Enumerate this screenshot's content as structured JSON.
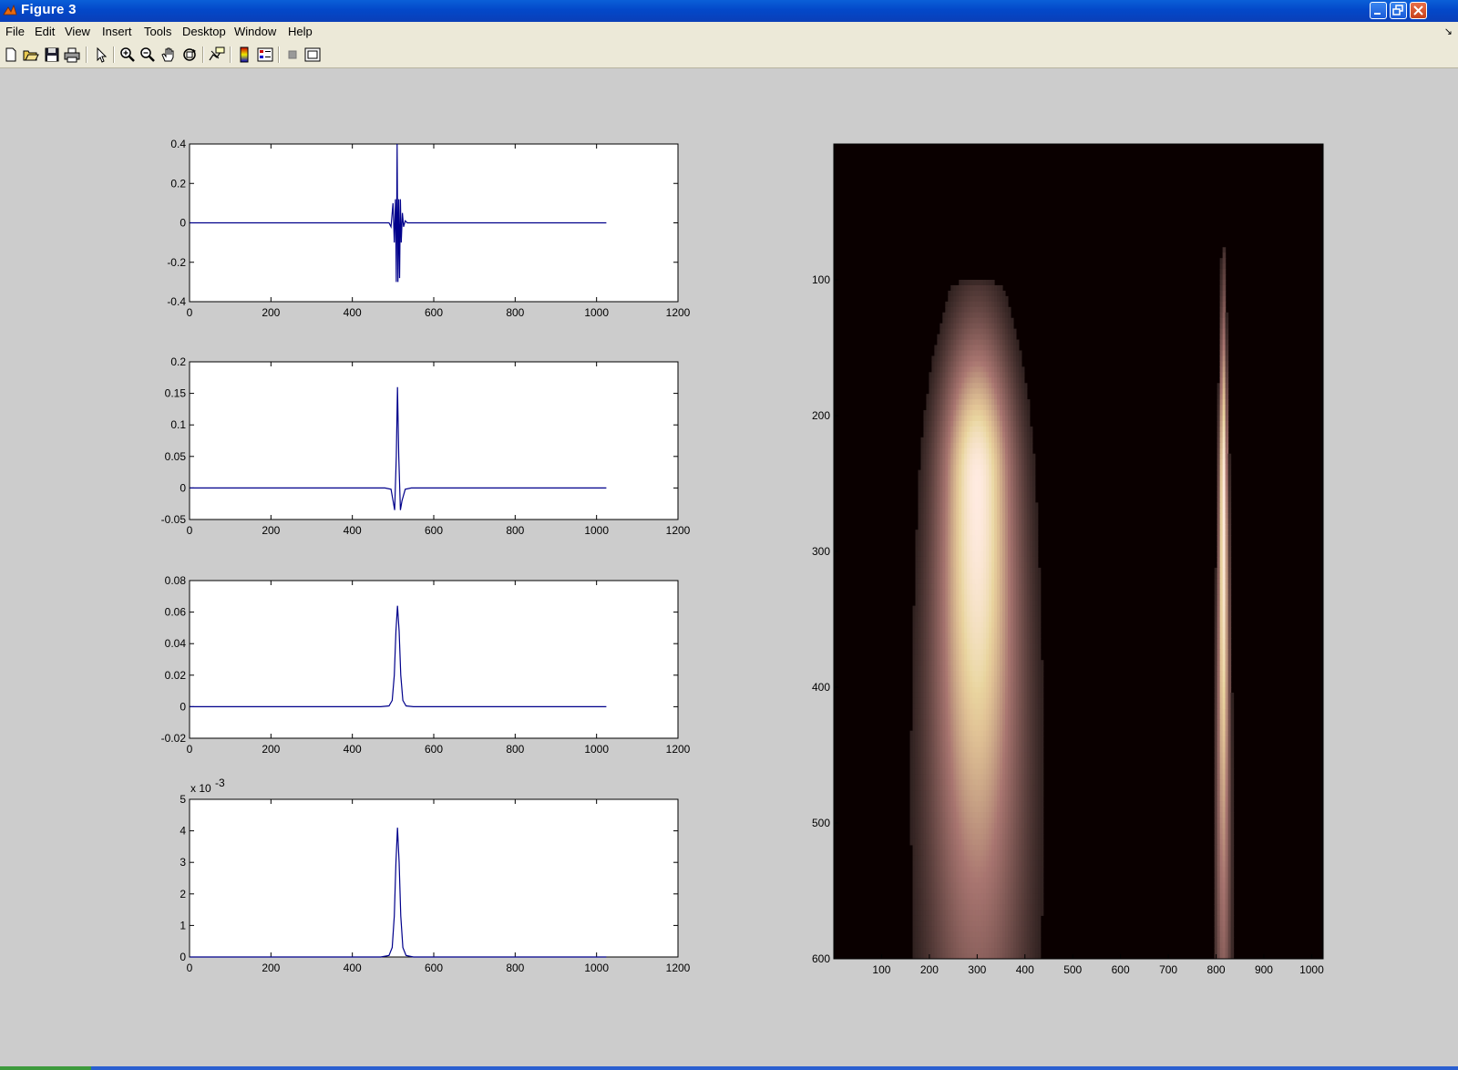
{
  "window": {
    "title": "Figure 3"
  },
  "menu": {
    "items": [
      "File",
      "Edit",
      "View",
      "Insert",
      "Tools",
      "Desktop",
      "Window",
      "Help"
    ]
  },
  "toolbar": {
    "icons": [
      "new-figure-icon",
      "open-file-icon",
      "save-icon",
      "print-icon",
      "edit-plot-arrow-icon",
      "zoom-in-icon",
      "zoom-out-icon",
      "pan-hand-icon",
      "rotate-3d-icon",
      "data-cursor-icon",
      "colorbar-icon",
      "legend-icon",
      "hide-plot-tools-icon",
      "show-plot-tools-icon"
    ]
  },
  "chart_data": [
    {
      "type": "line",
      "xlim": [
        0,
        1200
      ],
      "ylim": [
        -0.4,
        0.4
      ],
      "xticks": [
        "0",
        "200",
        "400",
        "600",
        "800",
        "1000",
        "1200"
      ],
      "yticks": [
        "-0.4",
        "-0.2",
        "0",
        "0.2",
        "0.4"
      ],
      "exponent": "",
      "color": "#00008b",
      "x": [
        1,
        490,
        495,
        500,
        503,
        506,
        508,
        510,
        512,
        514,
        516,
        518,
        520,
        523,
        526,
        530,
        535,
        1024
      ],
      "y": [
        0,
        0,
        -0.02,
        0.1,
        -0.1,
        0.12,
        -0.3,
        0.4,
        -0.3,
        0.12,
        -0.28,
        0.12,
        -0.1,
        0.05,
        -0.02,
        0.01,
        0,
        0
      ]
    },
    {
      "type": "line",
      "xlim": [
        0,
        1200
      ],
      "ylim": [
        -0.05,
        0.2
      ],
      "xticks": [
        "0",
        "200",
        "400",
        "600",
        "800",
        "1000",
        "1200"
      ],
      "yticks": [
        "-0.05",
        "0",
        "0.05",
        "0.1",
        "0.15",
        "0.2"
      ],
      "exponent": "",
      "color": "#00008b",
      "x": [
        1,
        480,
        495,
        500,
        504,
        508,
        511,
        514,
        518,
        522,
        530,
        545,
        1024
      ],
      "y": [
        0,
        0,
        -0.002,
        -0.02,
        -0.035,
        0.05,
        0.16,
        0.05,
        -0.035,
        -0.02,
        -0.002,
        0,
        0
      ]
    },
    {
      "type": "line",
      "xlim": [
        0,
        1200
      ],
      "ylim": [
        -0.02,
        0.08
      ],
      "xticks": [
        "0",
        "200",
        "400",
        "600",
        "800",
        "1000",
        "1200"
      ],
      "yticks": [
        "-0.02",
        "0",
        "0.02",
        "0.04",
        "0.06",
        "0.08"
      ],
      "exponent": "",
      "color": "#00008b",
      "x": [
        1,
        470,
        490,
        498,
        503,
        507,
        511,
        515,
        519,
        524,
        532,
        550,
        1024
      ],
      "y": [
        0,
        0,
        0.0005,
        0.004,
        0.02,
        0.048,
        0.064,
        0.048,
        0.02,
        0.004,
        0.0005,
        0,
        0
      ]
    },
    {
      "type": "line",
      "xlim": [
        0,
        1200
      ],
      "ylim": [
        0,
        5
      ],
      "xticks": [
        "0",
        "200",
        "400",
        "600",
        "800",
        "1000",
        "1200"
      ],
      "yticks": [
        "0",
        "1",
        "2",
        "3",
        "4",
        "5"
      ],
      "exponent": "x 10",
      "exponent_power": "-3",
      "color": "#00008b",
      "x": [
        1,
        470,
        490,
        498,
        503,
        507,
        511,
        515,
        519,
        524,
        532,
        550,
        1024
      ],
      "y": [
        0,
        0,
        0.05,
        0.3,
        1.3,
        3.0,
        4.1,
        3.0,
        1.3,
        0.3,
        0.05,
        0,
        0
      ]
    },
    {
      "type": "heatmap",
      "colormap": "pink",
      "xlim": [
        0,
        1024
      ],
      "ylim": [
        600,
        0
      ],
      "xticks": [
        "100",
        "200",
        "300",
        "400",
        "500",
        "600",
        "700",
        "800",
        "900",
        "1000"
      ],
      "yticks": [
        "100",
        "200",
        "300",
        "400",
        "500",
        "600"
      ],
      "blobs": [
        {
          "center_x": 300,
          "center_y": 250,
          "peak": 1.0,
          "sigma_x_top": 55,
          "sigma_x_bottom": 90,
          "top_y": 105,
          "fade_y": 330
        },
        {
          "center_x": 815,
          "center_y": 255,
          "peak": 1.0,
          "sigma_x_top": 4,
          "sigma_x_bottom": 14,
          "top_y": 80,
          "fade_y": 180
        }
      ],
      "background_color": "#0a0000"
    }
  ]
}
